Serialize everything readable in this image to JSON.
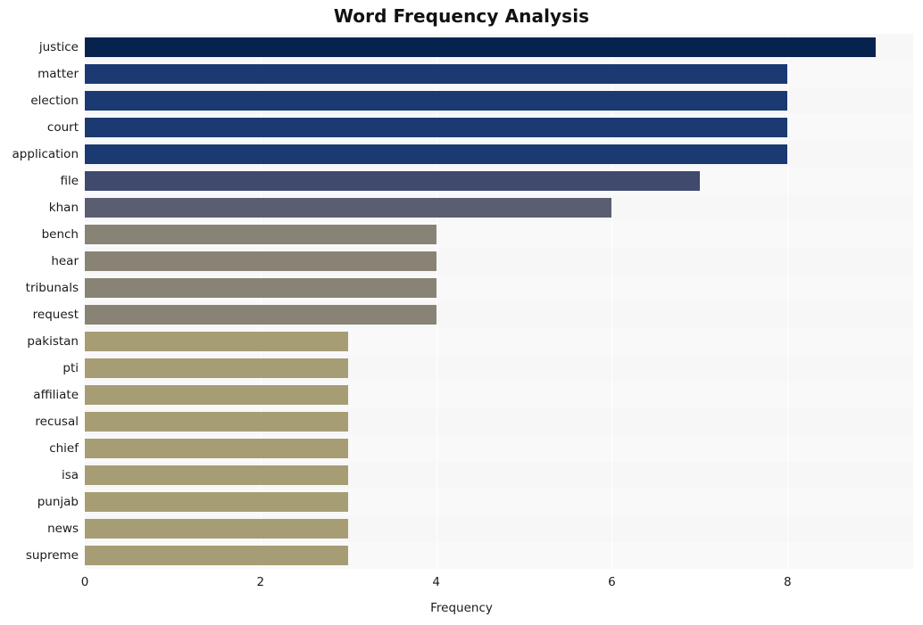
{
  "chart_data": {
    "type": "bar",
    "orientation": "horizontal",
    "title": "Word Frequency Analysis",
    "xlabel": "Frequency",
    "ylabel": "",
    "categories": [
      "justice",
      "matter",
      "election",
      "court",
      "application",
      "file",
      "khan",
      "bench",
      "hear",
      "tribunals",
      "request",
      "pakistan",
      "pti",
      "affiliate",
      "recusal",
      "chief",
      "isa",
      "punjab",
      "news",
      "supreme"
    ],
    "values": [
      9,
      8,
      8,
      8,
      8,
      7,
      6,
      4,
      4,
      4,
      4,
      3,
      3,
      3,
      3,
      3,
      3,
      3,
      3,
      3
    ],
    "bar_colors": [
      "#06234e",
      "#1b3a72",
      "#1b3a72",
      "#1b3a72",
      "#1b3a72",
      "#40496e",
      "#5a5e70",
      "#888375",
      "#888375",
      "#888375",
      "#888375",
      "#a79d74",
      "#a79d74",
      "#a79d74",
      "#a79d74",
      "#a79d74",
      "#a79d74",
      "#a79d74",
      "#a79d74",
      "#a79d74"
    ],
    "xlim": [
      0,
      9.43
    ],
    "xticks": [
      0,
      2,
      4,
      6,
      8
    ],
    "xtick_labels": [
      "0",
      "2",
      "4",
      "6",
      "8"
    ],
    "grid": true,
    "grid_axis": "x",
    "legend": null,
    "plot_background": "#f7f7f8",
    "figure_background": "#ffffff",
    "title_color": "#111111",
    "tick_label_color": "#1a1a1a"
  }
}
